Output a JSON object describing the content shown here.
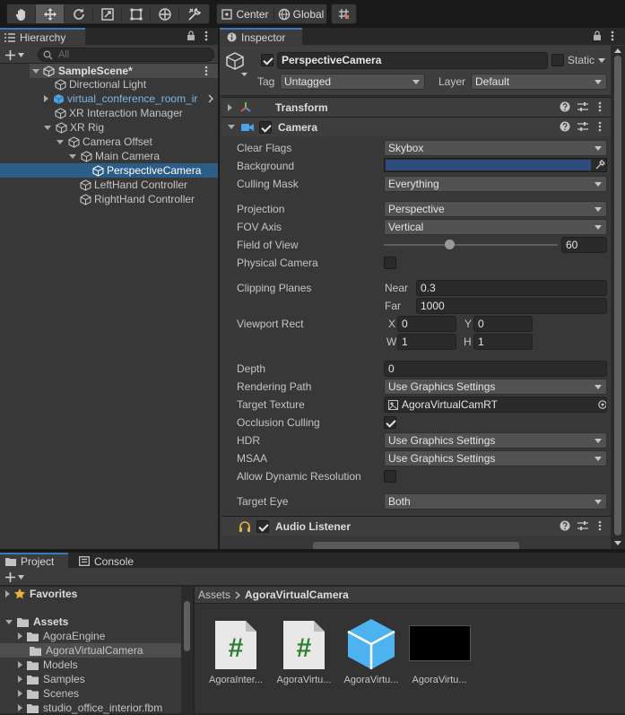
{
  "toolbar": {
    "tools": [
      "hand-tool",
      "move-tool",
      "rotate-tool",
      "scale-tool",
      "rect-tool",
      "transform-tool",
      "custom-tool"
    ],
    "pivot_label": "Center",
    "space_label": "Global"
  },
  "hierarchy": {
    "tab_label": "Hierarchy",
    "search_placeholder": "All",
    "scene_name": "SampleScene*",
    "items": [
      {
        "label": "Directional Light"
      },
      {
        "label": "virtual_conference_room_ir"
      },
      {
        "label": "XR Interaction Manager"
      },
      {
        "label": "XR Rig"
      },
      {
        "label": "Camera Offset"
      },
      {
        "label": "Main Camera"
      },
      {
        "label": "PerspectiveCamera"
      },
      {
        "label": "LeftHand Controller"
      },
      {
        "label": "RightHand Controller"
      }
    ]
  },
  "inspector": {
    "tab_label": "Inspector",
    "object_name": "PerspectiveCamera",
    "static_label": "Static",
    "tag_label": "Tag",
    "tag_value": "Untagged",
    "layer_label": "Layer",
    "layer_value": "Default",
    "transform_label": "Transform",
    "camera_label": "Camera",
    "audio_listener_label": "Audio Listener",
    "camera": {
      "clear_flags": {
        "label": "Clear Flags",
        "value": "Skybox"
      },
      "background": {
        "label": "Background",
        "color": "#2e4c7c"
      },
      "culling_mask": {
        "label": "Culling Mask",
        "value": "Everything"
      },
      "projection": {
        "label": "Projection",
        "value": "Perspective"
      },
      "fov_axis": {
        "label": "FOV Axis",
        "value": "Vertical"
      },
      "field_of_view": {
        "label": "Field of View",
        "value": "60",
        "slider_fraction": 0.37
      },
      "physical_camera": {
        "label": "Physical Camera"
      },
      "clipping_planes": {
        "label": "Clipping Planes",
        "near_label": "Near",
        "near": "0.3",
        "far_label": "Far",
        "far": "1000"
      },
      "viewport_rect": {
        "label": "Viewport Rect",
        "x_label": "X",
        "x": "0",
        "y_label": "Y",
        "y": "0",
        "w_label": "W",
        "w": "1",
        "h_label": "H",
        "h": "1"
      },
      "depth": {
        "label": "Depth",
        "value": "0"
      },
      "rendering_path": {
        "label": "Rendering Path",
        "value": "Use Graphics Settings"
      },
      "target_texture": {
        "label": "Target Texture",
        "value": "AgoraVirtualCamRT"
      },
      "occlusion_culling": {
        "label": "Occlusion Culling"
      },
      "hdr": {
        "label": "HDR",
        "value": "Use Graphics Settings"
      },
      "msaa": {
        "label": "MSAA",
        "value": "Use Graphics Settings"
      },
      "allow_dynamic_resolution": {
        "label": "Allow Dynamic Resolution"
      },
      "target_eye": {
        "label": "Target Eye",
        "value": "Both"
      }
    }
  },
  "project": {
    "tab_label": "Project",
    "console_tab_label": "Console",
    "favorites_label": "Favorites",
    "assets_label": "Assets",
    "folders": [
      "AgoraEngine",
      "AgoraVirtualCamera",
      "Models",
      "Samples",
      "Scenes",
      "studio_office_interior.fbm"
    ],
    "breadcrumb": [
      "Assets",
      "AgoraVirtualCamera"
    ],
    "asset_items": [
      {
        "label": "AgoraInter...",
        "icon": "csharp-script-icon"
      },
      {
        "label": "AgoraVirtu...",
        "icon": "csharp-script-icon"
      },
      {
        "label": "AgoraVirtu...",
        "icon": "prefab-cube-icon"
      },
      {
        "label": "AgoraVirtu...",
        "icon": "render-texture-icon"
      }
    ]
  },
  "colors": {
    "selection": "#2c5d87",
    "accent": "#3a79bb",
    "prefab_blue": "#7bb7e8"
  }
}
